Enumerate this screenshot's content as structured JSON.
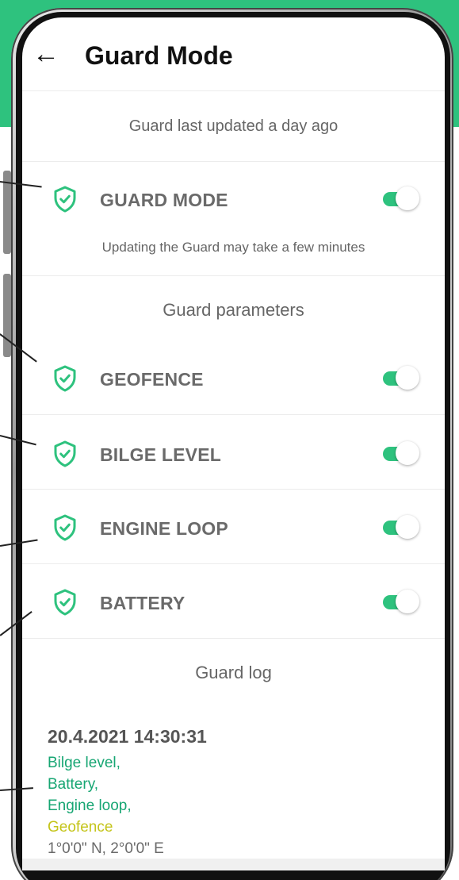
{
  "header": {
    "back_icon": "arrow-left-icon",
    "title": "Guard Mode"
  },
  "status": {
    "last_updated": "Guard last updated a day ago"
  },
  "guard_mode": {
    "label": "GUARD MODE",
    "enabled": true,
    "note": "Updating the Guard may take a few minutes"
  },
  "parameters": {
    "heading": "Guard parameters",
    "items": [
      {
        "label": "GEOFENCE",
        "enabled": true
      },
      {
        "label": "BILGE LEVEL",
        "enabled": true
      },
      {
        "label": "ENGINE LOOP",
        "enabled": true
      },
      {
        "label": "BATTERY",
        "enabled": true
      }
    ]
  },
  "log": {
    "heading": "Guard log",
    "entries": [
      {
        "time": "20.4.2021 14:30:31",
        "lines": [
          "Bilge level,",
          "Battery,",
          "Engine loop,",
          "Geofence"
        ],
        "coords": "1°0'0\" N, 2°0'0\" E"
      }
    ]
  },
  "colors": {
    "accent": "#2ec27e",
    "log_ok": "#17a673",
    "log_warn": "#c4c41a",
    "label_gray": "#6a6a6a"
  }
}
